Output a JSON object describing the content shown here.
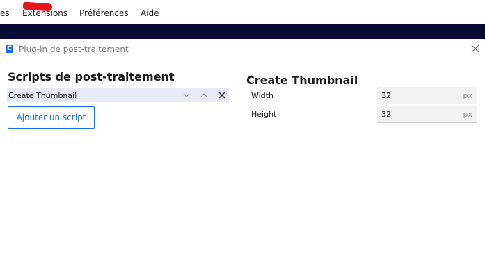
{
  "menubar": {
    "items": [
      {
        "label": "es"
      },
      {
        "label": "Extensions"
      },
      {
        "label": "Préférences"
      },
      {
        "label": "Aide"
      }
    ]
  },
  "dialog": {
    "title": "Plug-in de post-traitement",
    "app_icon_glyph": "C"
  },
  "scripts_panel": {
    "title": "Scripts de post-traitement",
    "scripts": [
      {
        "name": "Create Thumbnail"
      }
    ],
    "add_button_label": "Ajouter un script"
  },
  "settings_panel": {
    "title": "Create Thumbnail",
    "settings": [
      {
        "label": "Width",
        "value": "32",
        "unit": "px"
      },
      {
        "label": "Height",
        "value": "32",
        "unit": "px"
      }
    ]
  },
  "colors": {
    "accent": "#196ef0",
    "navbar": "#080b36",
    "selected_row": "#e8eaf8",
    "field_bg": "#f2f2f2",
    "annotation_mark": "#e8141e"
  },
  "icons": {
    "row_actions": [
      "chevron-down-icon",
      "chevron-up-icon",
      "remove-icon"
    ],
    "dialog_close": "close-icon"
  }
}
